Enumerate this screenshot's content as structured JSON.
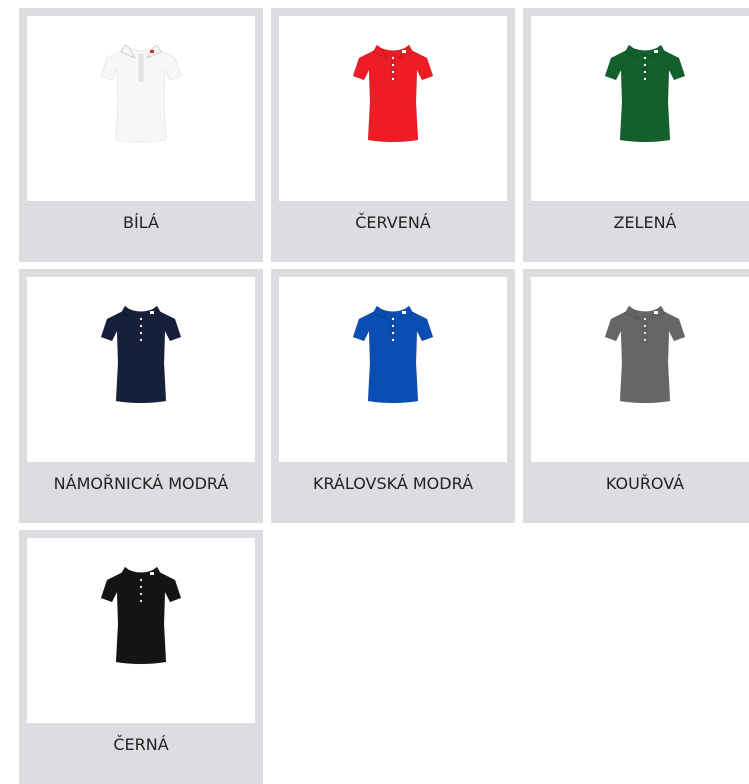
{
  "swatches": [
    {
      "label": "BÍLÁ",
      "color": "#f7f7f5",
      "button_color": "#e2e2e2",
      "logo": "#c0392b"
    },
    {
      "label": "ČERVENÁ",
      "color": "#ee1c25",
      "button_color": "#ffffff",
      "logo": "#ffffff"
    },
    {
      "label": "ZELENÁ",
      "color": "#13602c",
      "button_color": "#ffffff",
      "logo": "#ffffff"
    },
    {
      "label": "NÁMOŘNICKÁ MODRÁ",
      "color": "#16203a",
      "button_color": "#e8e8e8",
      "logo": "#ffffff"
    },
    {
      "label": "KRÁLOVSKÁ MODRÁ",
      "color": "#0a4db3",
      "button_color": "#ffffff",
      "logo": "#ffffff"
    },
    {
      "label": "KOUŘOVÁ",
      "color": "#666666",
      "button_color": "#e8e8e8",
      "logo": "#ffffff"
    },
    {
      "label": "ČERNÁ",
      "color": "#141414",
      "button_color": "#d8d8d8",
      "logo": "#ffffff"
    }
  ]
}
